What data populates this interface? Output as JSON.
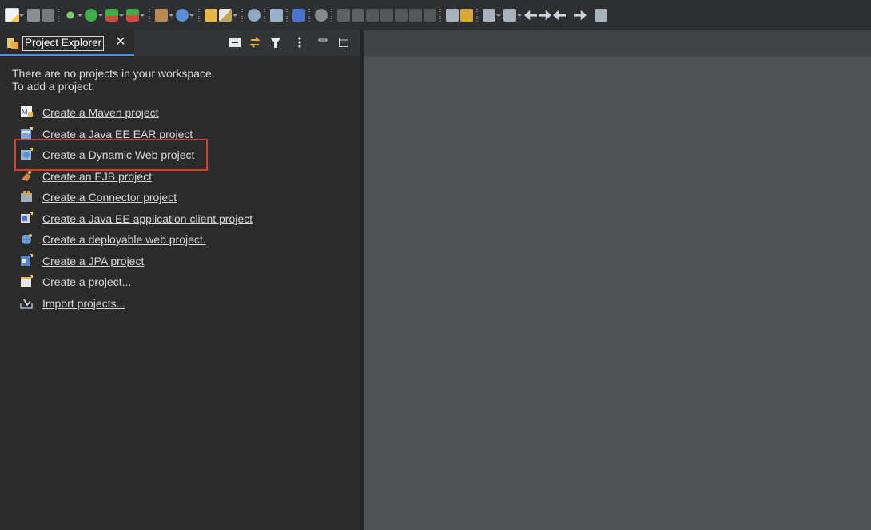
{
  "toolbar": {
    "icons": [
      "new-wizard-icon",
      "save-icon",
      "save-all-icon",
      "debug-icon",
      "run-icon",
      "run-coverage-icon",
      "external-tools-icon",
      "new-server-icon",
      "new-web-service-icon",
      "open-folder-icon",
      "edit-icon",
      "globe-icon",
      "tool-icon",
      "console-icon",
      "link-icon",
      "resume-icon",
      "suspend-icon",
      "terminate-icon",
      "disconnect-icon",
      "step-into-icon",
      "step-over-icon",
      "step-return-icon",
      "drop-to-frame-icon",
      "use-step-filters-icon",
      "annotation-icon",
      "last-edit-icon",
      "back-icon",
      "forward-icon",
      "pin-editor-icon"
    ]
  },
  "view": {
    "tab_label": "Project Explorer",
    "tab_close": "✕",
    "message_line1": "There are no projects in your workspace.",
    "message_line2": "To add a project:",
    "links": [
      {
        "label": "Create a Maven project",
        "icon": "maven-icon"
      },
      {
        "label": "Create a Java EE EAR project",
        "icon": "ear-project-icon"
      },
      {
        "label": "Create a Dynamic Web project",
        "icon": "dynamic-web-icon"
      },
      {
        "label": "Create an EJB project",
        "icon": "ejb-icon"
      },
      {
        "label": "Create a Connector project",
        "icon": "connector-icon"
      },
      {
        "label": "Create a Java EE application client project",
        "icon": "app-client-icon"
      },
      {
        "label": "Create a deployable web project.",
        "icon": "deployable-web-icon"
      },
      {
        "label": "Create a JPA project",
        "icon": "jpa-icon"
      },
      {
        "label": "Create a project...",
        "icon": "new-project-icon"
      },
      {
        "label": "Import projects...",
        "icon": "import-icon"
      }
    ]
  },
  "colors": {
    "highlight": "#d93d30",
    "link_text": "#d8d8d8",
    "editor_bg": "#4f5254"
  }
}
